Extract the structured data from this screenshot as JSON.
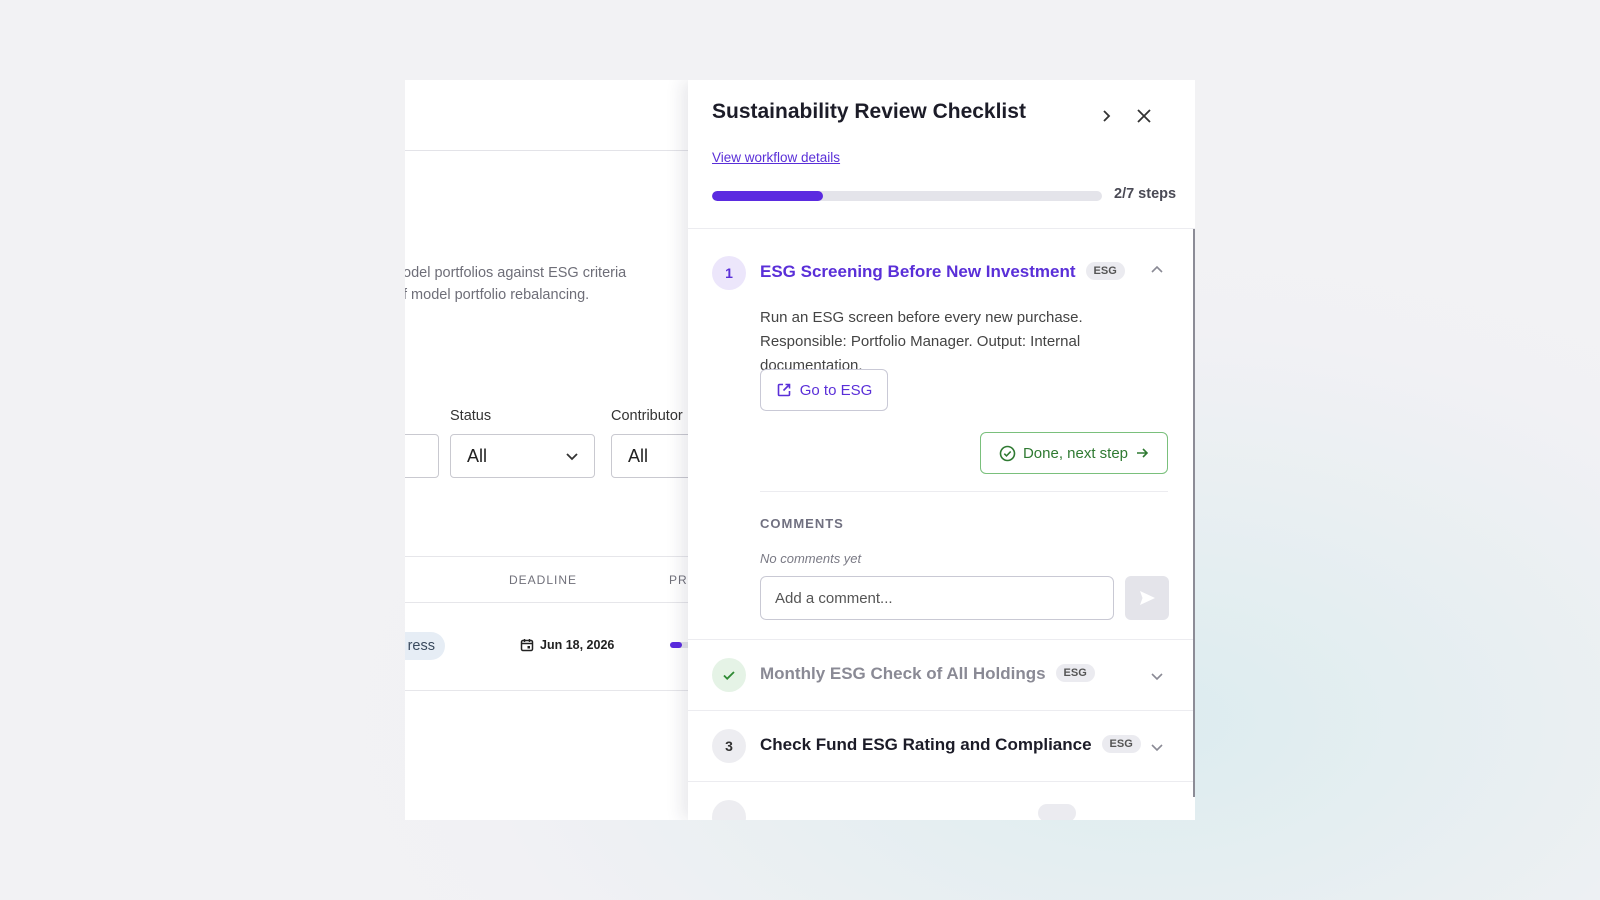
{
  "background_page": {
    "description_line1": "odel portfolios against ESG criteria",
    "description_line2": "f model portfolio rebalancing.",
    "filters": {
      "status_label": "Status",
      "status_value": "All",
      "contributor_label": "Contributor",
      "contributor_value": "All"
    },
    "table": {
      "col_deadline": "DEADLINE",
      "col_progress": "PRO",
      "row": {
        "status": "ress",
        "deadline": "Jun 18, 2026",
        "progress_fraction": 0.3
      }
    }
  },
  "panel": {
    "title": "Sustainability Review Checklist",
    "workflow_link": "View workflow details",
    "progress": {
      "completed": 2,
      "total": 7,
      "label": "2/7 steps",
      "fraction": 0.2857
    },
    "accent_color": "#5b2be0",
    "steps": [
      {
        "number": "1",
        "title": "ESG Screening Before New Investment",
        "tag": "ESG",
        "state": "active",
        "description": "Run an ESG screen before every new purchase. Responsible: Portfolio Manager. Output: Internal documentation.",
        "goto_label": "Go to ESG",
        "done_label": "Done, next step",
        "comments_label": "COMMENTS",
        "no_comments": "No comments yet",
        "comment_placeholder": "Add a comment..."
      },
      {
        "number": "",
        "title": "Monthly ESG Check of All Holdings",
        "tag": "ESG",
        "state": "done"
      },
      {
        "number": "3",
        "title": "Check Fund ESG Rating and Compliance",
        "tag": "ESG",
        "state": "pending"
      }
    ]
  }
}
